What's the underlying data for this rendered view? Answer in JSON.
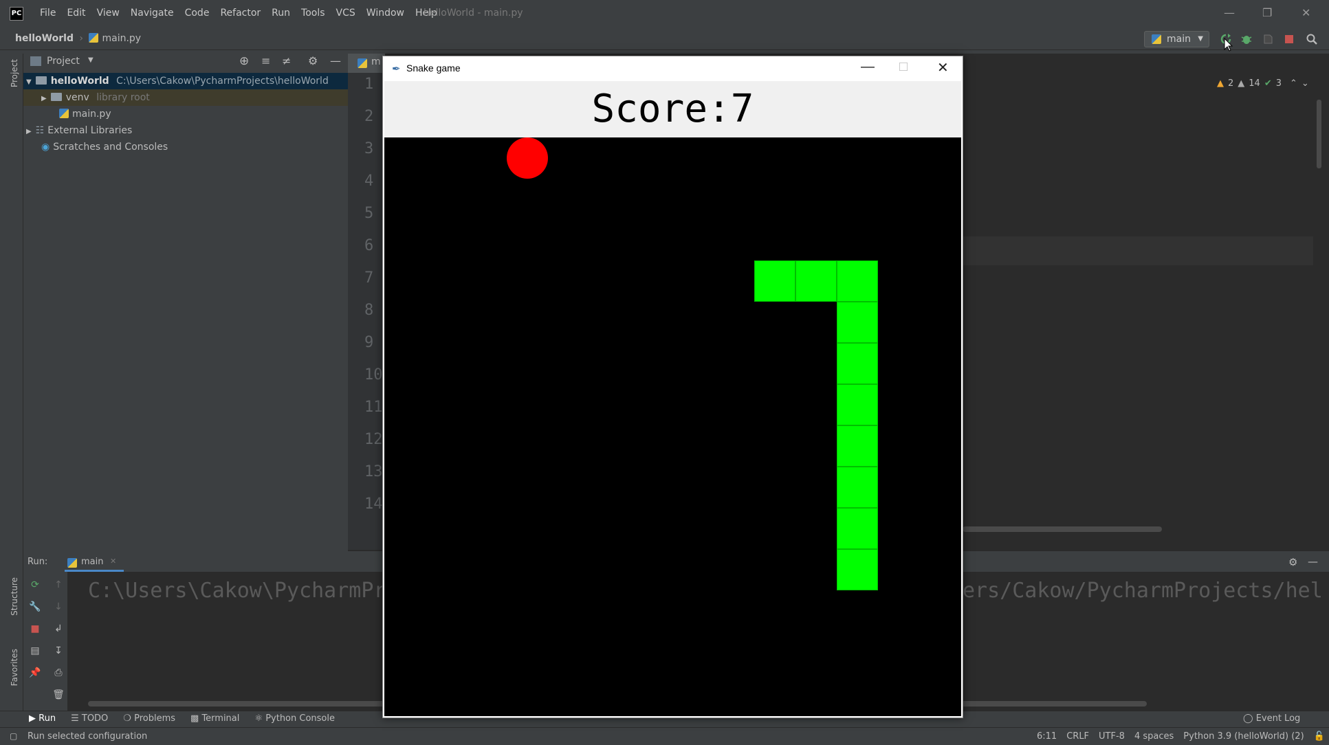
{
  "ide": {
    "menu": [
      "File",
      "Edit",
      "View",
      "Navigate",
      "Code",
      "Refactor",
      "Run",
      "Tools",
      "VCS",
      "Window",
      "Help"
    ],
    "window_title": "helloWorld - main.py",
    "breadcrumb": {
      "project": "helloWorld",
      "file": "main.py"
    },
    "run_config": "main",
    "project_panel": {
      "title": "Project",
      "tree": [
        {
          "label": "helloWorld",
          "detail": "C:\\Users\\Cakow\\PycharmProjects\\helloWorld"
        },
        {
          "label": "venv",
          "detail": "library root"
        },
        {
          "label": "main.py",
          "detail": ""
        },
        {
          "label": "External Libraries",
          "detail": ""
        },
        {
          "label": "Scratches and Consoles",
          "detail": ""
        }
      ]
    },
    "editor": {
      "tab_label": "m",
      "line_numbers": [
        "1",
        "2",
        "3",
        "4",
        "5",
        "6",
        "7",
        "8",
        "9",
        "10",
        "11",
        "12",
        "13",
        "14"
      ],
      "inspections": {
        "warnings": "2",
        "weak_warnings": "14",
        "ok": "3"
      }
    },
    "run_panel": {
      "label": "Run:",
      "tab": "main",
      "output_left": "C:\\Users\\Cakow\\PycharmPr",
      "output_right": "ers/Cakow/PycharmProjects/hel"
    },
    "left_stripe": {
      "project": "Project",
      "structure": "Structure",
      "favorites": "Favorites"
    },
    "tool_tabs": [
      "Run",
      "TODO",
      "Problems",
      "Terminal",
      "Python Console"
    ],
    "event_log": "Event Log",
    "status": {
      "message": "Run selected configuration",
      "position": "6:11",
      "line_sep": "CRLF",
      "encoding": "UTF-8",
      "indent": "4 spaces",
      "interpreter": "Python 3.9 (helloWorld) (2)"
    }
  },
  "game": {
    "title": "Snake game",
    "score_label": "Score:7",
    "colors": {
      "snake": "#00ff00",
      "food": "#ff0000",
      "board": "#000000"
    }
  }
}
